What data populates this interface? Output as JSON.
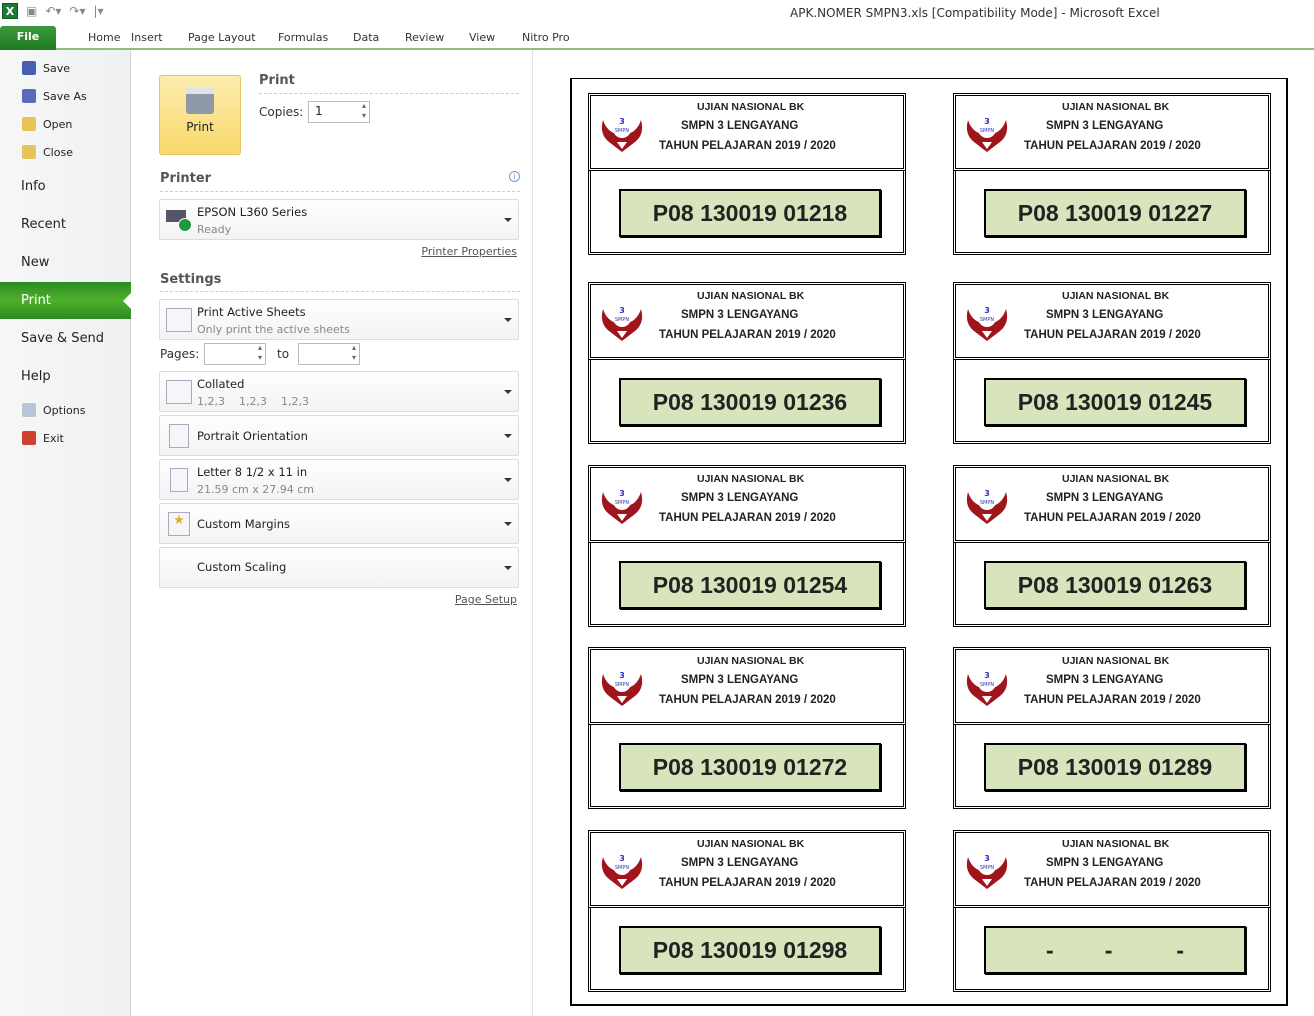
{
  "window": {
    "title": "APK.NOMER SMPN3.xls  [Compatibility Mode]  -  Microsoft Excel",
    "app_icon": "excel-icon"
  },
  "ribbon": {
    "file": "File",
    "tabs": [
      "Home",
      "Insert",
      "Page Layout",
      "Formulas",
      "Data",
      "Review",
      "View",
      "Nitro Pro"
    ]
  },
  "sidebar": {
    "items": [
      {
        "label": "Save",
        "icon": "save-icon",
        "color": "#4a5fb0"
      },
      {
        "label": "Save As",
        "icon": "save-as-icon",
        "color": "#5a6ab8"
      },
      {
        "label": "Open",
        "icon": "folder-open-icon",
        "color": "#e8c35a"
      },
      {
        "label": "Close",
        "icon": "folder-close-icon",
        "color": "#e8c35a"
      },
      {
        "label": "Info"
      },
      {
        "label": "Recent"
      },
      {
        "label": "New"
      },
      {
        "label": "Print",
        "active": true
      },
      {
        "label": "Save & Send"
      },
      {
        "label": "Help"
      },
      {
        "label": "Options",
        "icon": "options-icon",
        "color": "#b8c4d8"
      },
      {
        "label": "Exit",
        "icon": "exit-icon",
        "color": "#d04030"
      }
    ]
  },
  "print": {
    "heading": "Print",
    "button": "Print",
    "copies_label": "Copies:",
    "copies": "1"
  },
  "printer": {
    "heading": "Printer",
    "name": "EPSON L360 Series",
    "status": "Ready",
    "properties": "Printer Properties"
  },
  "settings": {
    "heading": "Settings",
    "what": {
      "title": "Print Active Sheets",
      "sub": "Only print the active sheets"
    },
    "pages_label": "Pages:",
    "to_label": "to",
    "pages_from": "",
    "pages_to": "",
    "collated": {
      "title": "Collated",
      "sub": "1,2,3    1,2,3    1,2,3"
    },
    "orientation": {
      "title": "Portrait Orientation"
    },
    "paper": {
      "title": "Letter 8 1/2 x 11 in",
      "sub": "21.59 cm x 27.94 cm"
    },
    "margins": {
      "title": "Custom Margins"
    },
    "scaling": {
      "title": "Custom Scaling"
    },
    "page_setup": "Page Setup"
  },
  "cards": {
    "line1": "UJIAN NASIONAL BK",
    "line2": "SMPN 3 LENGAYANG",
    "line3": "TAHUN PELAJARAN  2019 / 2020",
    "logo_text": "3 SMPN LENGAYANG",
    "numbers": [
      "P08 130019 01218",
      "P08 130019 01227",
      "P08 130019 01236",
      "P08 130019 01245",
      "P08 130019 01254",
      "P08 130019 01263",
      "P08 130019 01272",
      "P08 130019 01289",
      "P08 130019 01298",
      "-        -          -"
    ],
    "fill": "#d8e4bc"
  }
}
